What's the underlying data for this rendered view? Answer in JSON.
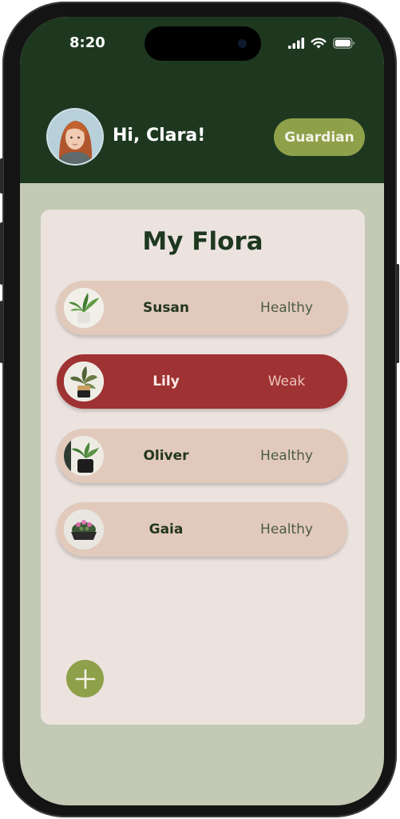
{
  "status_bar": {
    "time": "8:20"
  },
  "header": {
    "greeting": "Hi, Clara!",
    "role_label": "Guardian"
  },
  "card": {
    "title": "My Flora",
    "plants": [
      {
        "name": "Susan",
        "status": "Healthy"
      },
      {
        "name": "Lily",
        "status": "Weak"
      },
      {
        "name": "Oliver",
        "status": "Healthy"
      },
      {
        "name": "Gaia",
        "status": "Healthy"
      }
    ]
  },
  "colors": {
    "header_bg": "#1e3820",
    "accent_green": "#8fa04a",
    "row_healthy": "#e1cabc",
    "row_weak": "#9f3232",
    "card_bg": "#ece3df",
    "screen_bg": "#c3c9b4"
  },
  "icons": {
    "status": [
      "cellular-signal-icon",
      "wifi-icon",
      "battery-icon"
    ],
    "add": "plus-icon"
  }
}
